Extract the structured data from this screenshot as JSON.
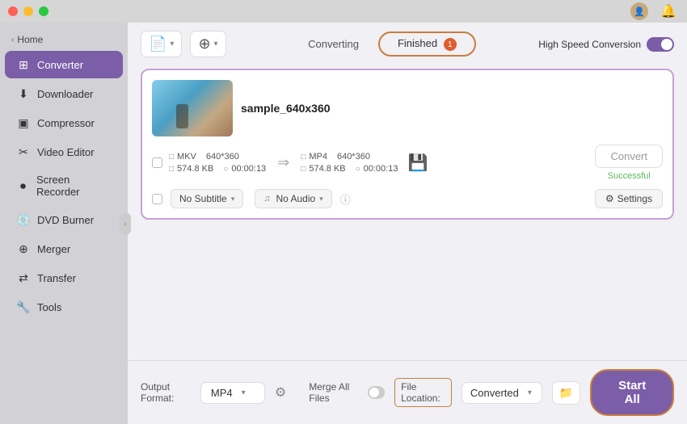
{
  "titlebar": {
    "traffic_lights": [
      "close",
      "minimize",
      "maximize"
    ]
  },
  "sidebar": {
    "home_label": "Home",
    "items": [
      {
        "id": "converter",
        "label": "Converter",
        "icon": "⊞",
        "active": true
      },
      {
        "id": "downloader",
        "label": "Downloader",
        "icon": "⬇"
      },
      {
        "id": "compressor",
        "label": "Compressor",
        "icon": "📦"
      },
      {
        "id": "video-editor",
        "label": "Video Editor",
        "icon": "✂"
      },
      {
        "id": "screen-recorder",
        "label": "Screen Recorder",
        "icon": "⏺"
      },
      {
        "id": "dvd-burner",
        "label": "DVD Burner",
        "icon": "💿"
      },
      {
        "id": "merger",
        "label": "Merger",
        "icon": "⊕"
      },
      {
        "id": "transfer",
        "label": "Transfer",
        "icon": "⇄"
      },
      {
        "id": "tools",
        "label": "Tools",
        "icon": "🔧"
      }
    ]
  },
  "toolbar": {
    "add_file_icon": "📄",
    "add_url_icon": "⊕"
  },
  "tabs": {
    "converting_label": "Converting",
    "finished_label": "Finished",
    "finished_badge": "1",
    "active": "finished"
  },
  "high_speed": {
    "label": "High Speed Conversion"
  },
  "file_card": {
    "filename": "sample_640x360",
    "source": {
      "format": "MKV",
      "resolution": "640*360",
      "size": "574.8 KB",
      "duration": "00:00:13"
    },
    "target": {
      "format": "MP4",
      "resolution": "640*360",
      "size": "574.8 KB",
      "duration": "00:00:13"
    },
    "convert_btn_label": "Convert",
    "success_label": "Successful",
    "subtitle_label": "No Subtitle",
    "audio_label": "No Audio",
    "settings_label": "Settings"
  },
  "bottom": {
    "output_format_label": "Output Format:",
    "output_format_value": "MP4",
    "merge_label": "Merge All Files",
    "file_location_label": "File Location:",
    "file_location_value": "Converted",
    "start_all_label": "Start All"
  }
}
